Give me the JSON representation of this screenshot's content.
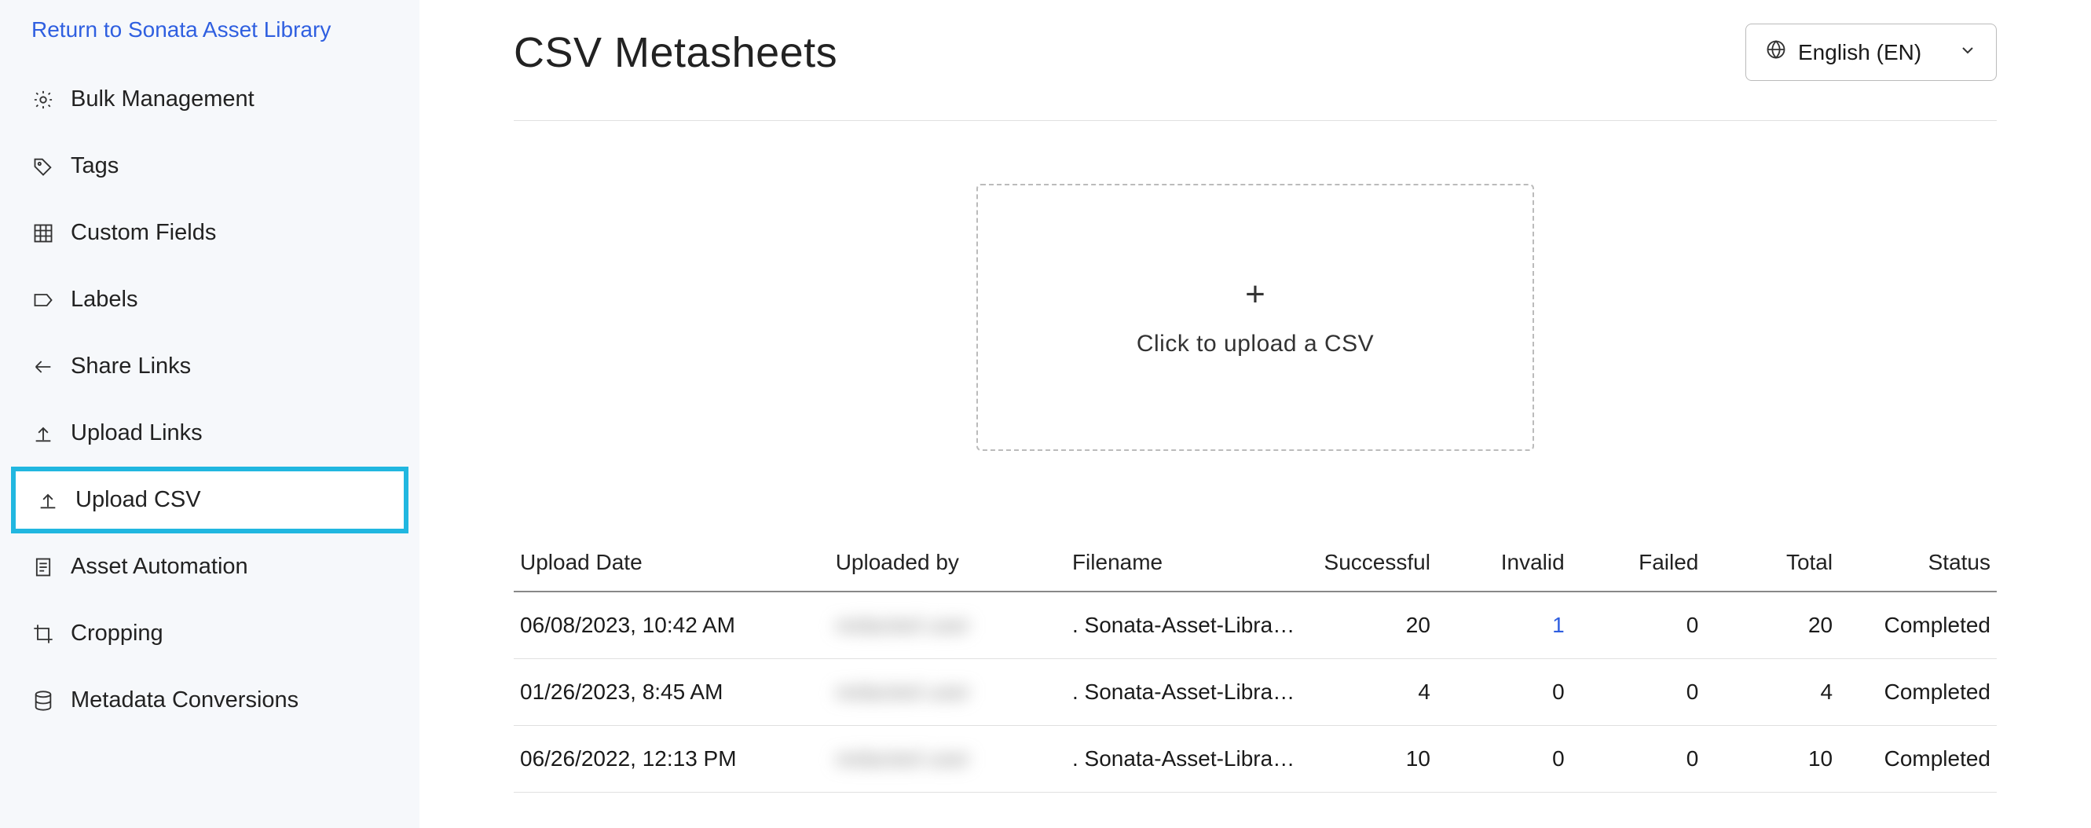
{
  "sidebar": {
    "return_label": "Return to Sonata Asset Library",
    "items": [
      {
        "label": "Bulk Management"
      },
      {
        "label": "Tags"
      },
      {
        "label": "Custom Fields"
      },
      {
        "label": "Labels"
      },
      {
        "label": "Share Links"
      },
      {
        "label": "Upload Links"
      },
      {
        "label": "Upload CSV"
      },
      {
        "label": "Asset Automation"
      },
      {
        "label": "Cropping"
      },
      {
        "label": "Metadata Conversions"
      }
    ]
  },
  "header": {
    "title": "CSV Metasheets",
    "language": "English (EN)"
  },
  "dropzone": {
    "text": "Click to upload a CSV"
  },
  "table": {
    "headers": {
      "date": "Upload Date",
      "by": "Uploaded by",
      "filename": "Filename",
      "successful": "Successful",
      "invalid": "Invalid",
      "failed": "Failed",
      "total": "Total",
      "status": "Status"
    },
    "rows": [
      {
        "date": "06/08/2023, 10:42 AM",
        "by": "redacted user",
        "filename": ". Sonata-Asset-Library…",
        "successful": "20",
        "invalid": "1",
        "invalid_link": true,
        "failed": "0",
        "total": "20",
        "status": "Completed"
      },
      {
        "date": "01/26/2023, 8:45 AM",
        "by": "redacted user",
        "filename": ". Sonata-Asset-Library…",
        "successful": "4",
        "invalid": "0",
        "invalid_link": false,
        "failed": "0",
        "total": "4",
        "status": "Completed"
      },
      {
        "date": "06/26/2022, 12:13 PM",
        "by": "redacted user",
        "filename": ". Sonata-Asset-Library…",
        "successful": "10",
        "invalid": "0",
        "invalid_link": false,
        "failed": "0",
        "total": "10",
        "status": "Completed"
      }
    ]
  }
}
